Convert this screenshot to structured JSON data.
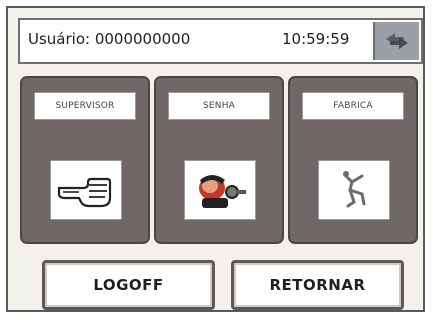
{
  "status": {
    "user_text": "Usuário: 0000000000",
    "time": "10:59:59",
    "right_icon": "swap-arrows-icon"
  },
  "cards": [
    {
      "label": "SUPERVISOR",
      "icon": "pointing-hand-icon"
    },
    {
      "label": "SENHA",
      "icon": "key-person-icon"
    },
    {
      "label": "FABRICA",
      "icon": "factory-figure-icon"
    }
  ],
  "buttons": {
    "logoff": "LOGOFF",
    "retornar": "RETORNAR"
  },
  "colors": {
    "card_bg": "#6f6866",
    "status_button_bg": "#9aa0a6"
  }
}
